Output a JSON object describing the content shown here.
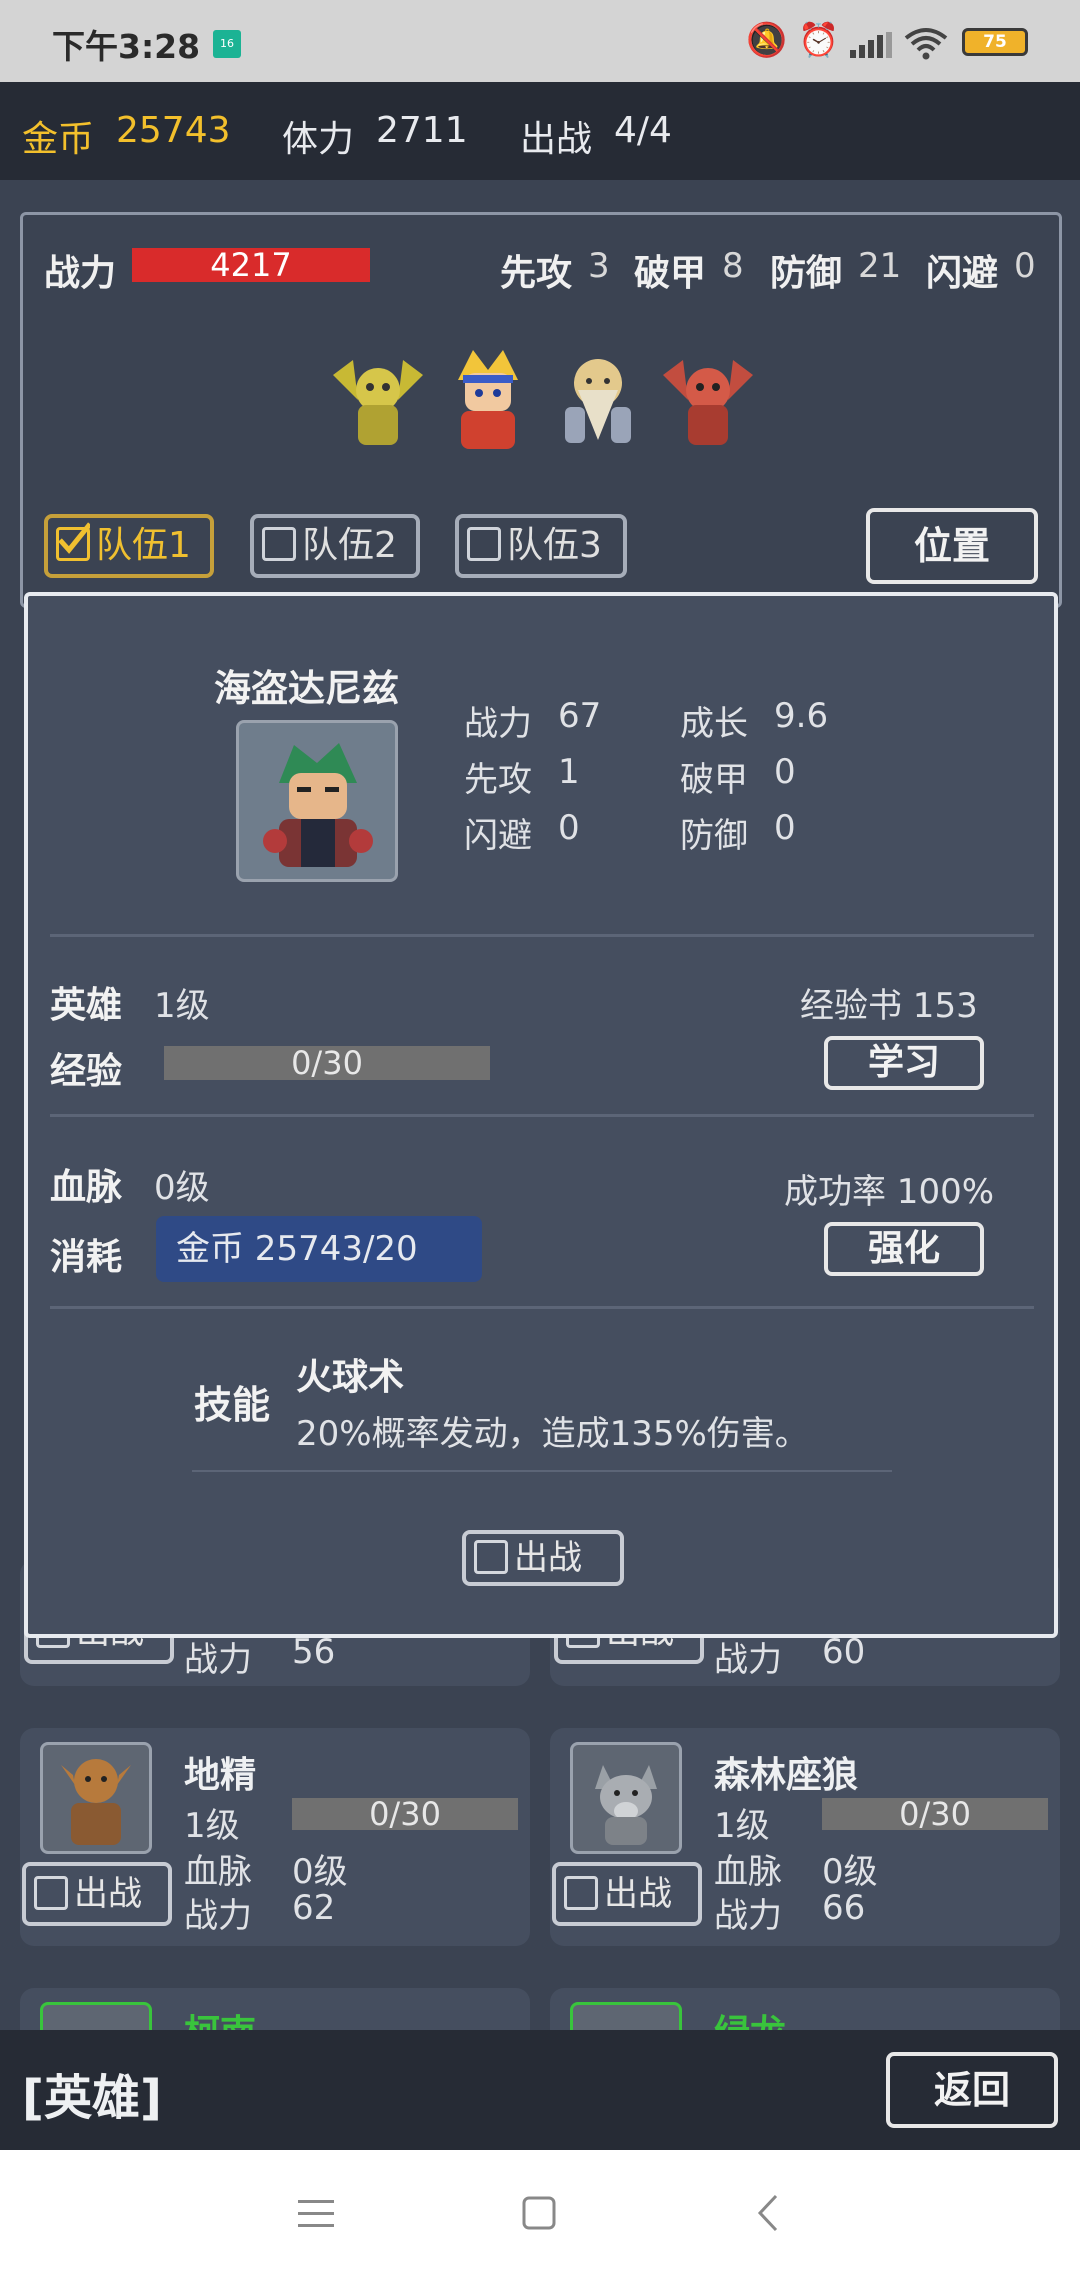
{
  "status_bar": {
    "time": "下午3:28",
    "app_badge": "16",
    "battery": "75"
  },
  "top_bar": {
    "gold_label": "金币",
    "gold_value": "25743",
    "stamina_label": "体力",
    "stamina_value": "2711",
    "deploy_label": "出战",
    "deploy_value": "4/4"
  },
  "team_panel": {
    "power_label": "战力",
    "power_value": "4217",
    "stats": [
      {
        "label": "先攻",
        "value": "3"
      },
      {
        "label": "破甲",
        "value": "8"
      },
      {
        "label": "防御",
        "value": "21"
      },
      {
        "label": "闪避",
        "value": "0"
      }
    ],
    "teams": [
      {
        "label": "队伍1",
        "checked": true
      },
      {
        "label": "队伍2",
        "checked": false
      },
      {
        "label": "队伍3",
        "checked": false
      }
    ],
    "position_button": "位置"
  },
  "hero_detail": {
    "name": "海盗达尼兹",
    "stats": [
      {
        "label": "战力",
        "value": "67"
      },
      {
        "label": "成长",
        "value": "9.6"
      },
      {
        "label": "先攻",
        "value": "1"
      },
      {
        "label": "破甲",
        "value": "0"
      },
      {
        "label": "闪避",
        "value": "0"
      },
      {
        "label": "防御",
        "value": "0"
      }
    ],
    "hero_label": "英雄",
    "hero_level": "1级",
    "exp_book": "经验书 153",
    "exp_label": "经验",
    "exp_text": "0/30",
    "exp_fraction": 0,
    "learn_button": "学习",
    "blood_label": "血脉",
    "blood_level": "0级",
    "success_rate": "成功率 100%",
    "cost_label": "消耗",
    "cost_value": "金币 25743/20",
    "strengthen_button": "强化",
    "skill_label": "技能",
    "skill_name": "火球术",
    "skill_desc": "20%概率发动，造成135%伤害。",
    "deploy_button": "出战"
  },
  "hero_cards_partial": [
    {
      "deploy": "出战",
      "power_label": "战力",
      "power": "56"
    },
    {
      "deploy": "出战",
      "power_label": "战力",
      "power": "60"
    }
  ],
  "hero_cards": [
    {
      "name": "地精",
      "level": "1级",
      "exp": "0/30",
      "blood_label": "血脉",
      "blood": "0级",
      "power_label": "战力",
      "power": "62",
      "deploy": "出战"
    },
    {
      "name": "森林座狼",
      "level": "1级",
      "exp": "0/30",
      "blood_label": "血脉",
      "blood": "0级",
      "power_label": "战力",
      "power": "66",
      "deploy": "出战"
    }
  ],
  "hero_cards_cut": [
    {
      "name": "柯南"
    },
    {
      "name": "绿龙"
    }
  ],
  "bottom_bar": {
    "title": "[英雄]",
    "back_button": "返回"
  },
  "colors": {
    "gold": "#f3c02c",
    "power_bar": "#d92b2b",
    "green_name": "#39c43c",
    "cost_highlight": "#2f4a86"
  }
}
